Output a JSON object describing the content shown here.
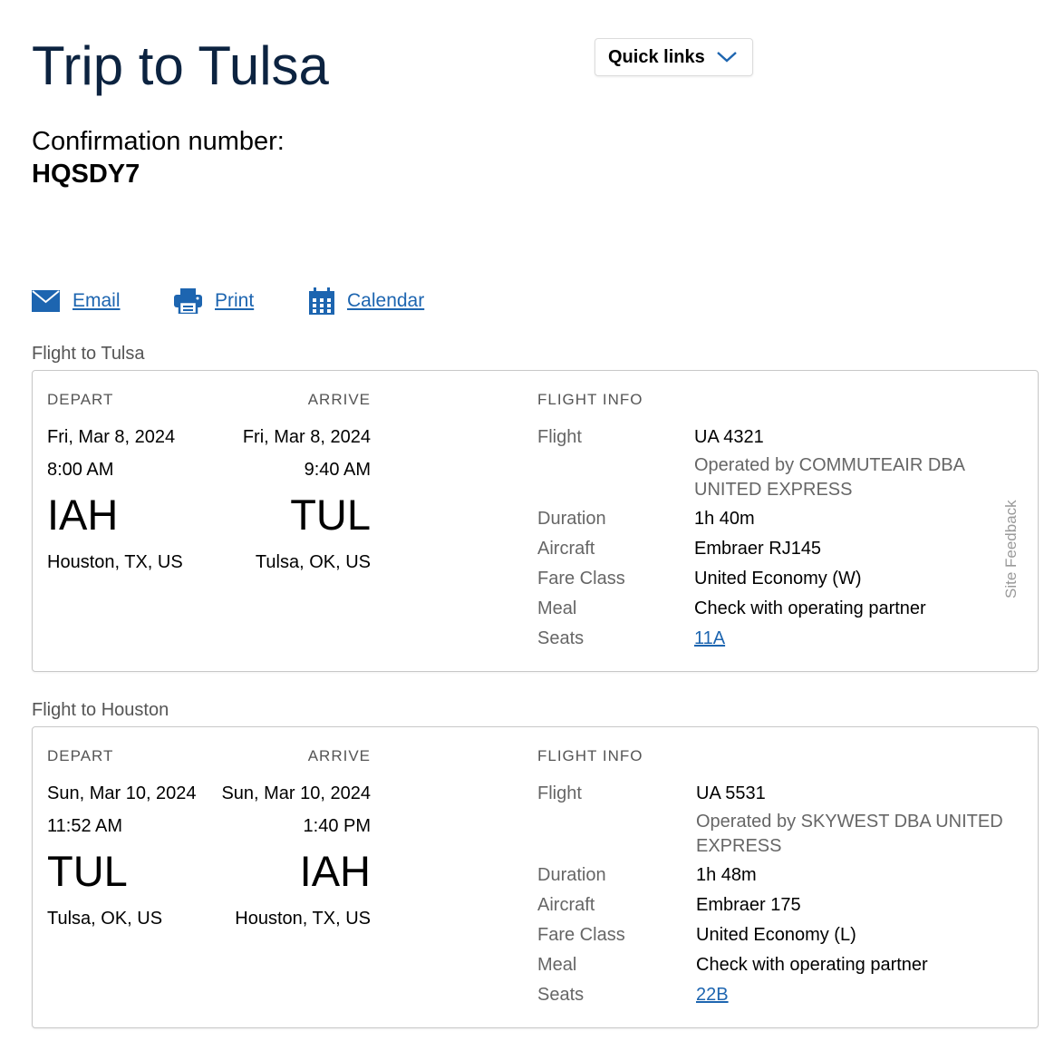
{
  "page": {
    "title": "Trip to Tulsa",
    "quick_links_label": "Quick links",
    "confirmation_label": "Confirmation number:",
    "confirmation_value": "HQSDY7"
  },
  "actions": {
    "email": "Email",
    "print": "Print",
    "calendar": "Calendar"
  },
  "side_tab": "Site Feedback",
  "colors": {
    "title": "#0c2340",
    "link": "#1d65b0",
    "muted": "#666666"
  },
  "flights": [
    {
      "section_title": "Flight to Tulsa",
      "depart_header": "DEPART",
      "arrive_header": "ARRIVE",
      "info_header": "FLIGHT INFO",
      "depart": {
        "date": "Fri, Mar 8, 2024",
        "time": "8:00 AM",
        "code": "IAH",
        "city": "Houston, TX, US"
      },
      "arrive": {
        "date": "Fri, Mar 8, 2024",
        "time": "9:40 AM",
        "code": "TUL",
        "city": "Tulsa, OK, US"
      },
      "info": {
        "flight_label": "Flight",
        "flight": "UA 4321",
        "operated_by": "Operated by COMMUTEAIR DBA UNITED EXPRESS",
        "duration_label": "Duration",
        "duration": "1h 40m",
        "aircraft_label": "Aircraft",
        "aircraft": "Embraer RJ145",
        "fare_label": "Fare Class",
        "fare": "United Economy (W)",
        "meal_label": "Meal",
        "meal": "Check with operating partner",
        "seats_label": "Seats",
        "seats": "11A"
      }
    },
    {
      "section_title": "Flight to Houston",
      "depart_header": "DEPART",
      "arrive_header": "ARRIVE",
      "info_header": "FLIGHT INFO",
      "depart": {
        "date": "Sun, Mar 10, 2024",
        "time": "11:52 AM",
        "code": "TUL",
        "city": "Tulsa, OK, US"
      },
      "arrive": {
        "date": "Sun, Mar 10, 2024",
        "time": "1:40 PM",
        "code": "IAH",
        "city": "Houston, TX, US"
      },
      "info": {
        "flight_label": "Flight",
        "flight": "UA 5531",
        "operated_by": "Operated by SKYWEST DBA UNITED EXPRESS",
        "duration_label": "Duration",
        "duration": "1h 48m",
        "aircraft_label": "Aircraft",
        "aircraft": "Embraer 175",
        "fare_label": "Fare Class",
        "fare": "United Economy (L)",
        "meal_label": "Meal",
        "meal": "Check with operating partner",
        "seats_label": "Seats",
        "seats": "22B"
      }
    }
  ]
}
